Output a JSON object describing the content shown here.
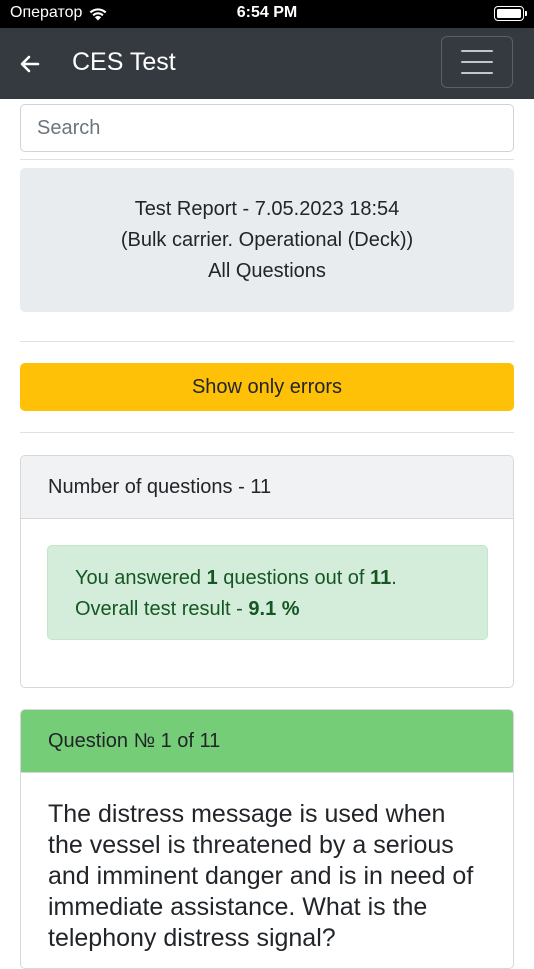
{
  "status_bar": {
    "carrier": "Оператор",
    "time": "6:54 PM"
  },
  "navbar": {
    "title": "CES Test",
    "back_icon": "arrow-left-icon",
    "menu_icon": "hamburger-menu-icon"
  },
  "search": {
    "placeholder": "Search",
    "value": ""
  },
  "report": {
    "line1": "Test Report - 7.05.2023 18:54",
    "line2": "(Bulk carrier. Operational (Deck))",
    "line3": "All Questions"
  },
  "filter_button": {
    "label": "Show only errors"
  },
  "summary": {
    "header": "Number of questions - 11",
    "answered_prefix": "You answered ",
    "answered_count": "1",
    "answered_middle": " questions out of ",
    "total_count": "11",
    "answered_suffix": ".",
    "result_prefix": "Overall test result - ",
    "result_value": "9.1 %"
  },
  "question": {
    "header": "Question № 1 of 11",
    "text": "The distress message is used when the vessel is threatened by a serious and imminent danger and is in need of immediate assistance. What is the telephony distress signal?"
  },
  "colors": {
    "navbar": "#343a40",
    "warning": "#ffc107",
    "success_header": "#76cd77",
    "alert_bg": "#d4edda",
    "alert_text": "#155724",
    "jumbotron": "#e9ecef"
  }
}
